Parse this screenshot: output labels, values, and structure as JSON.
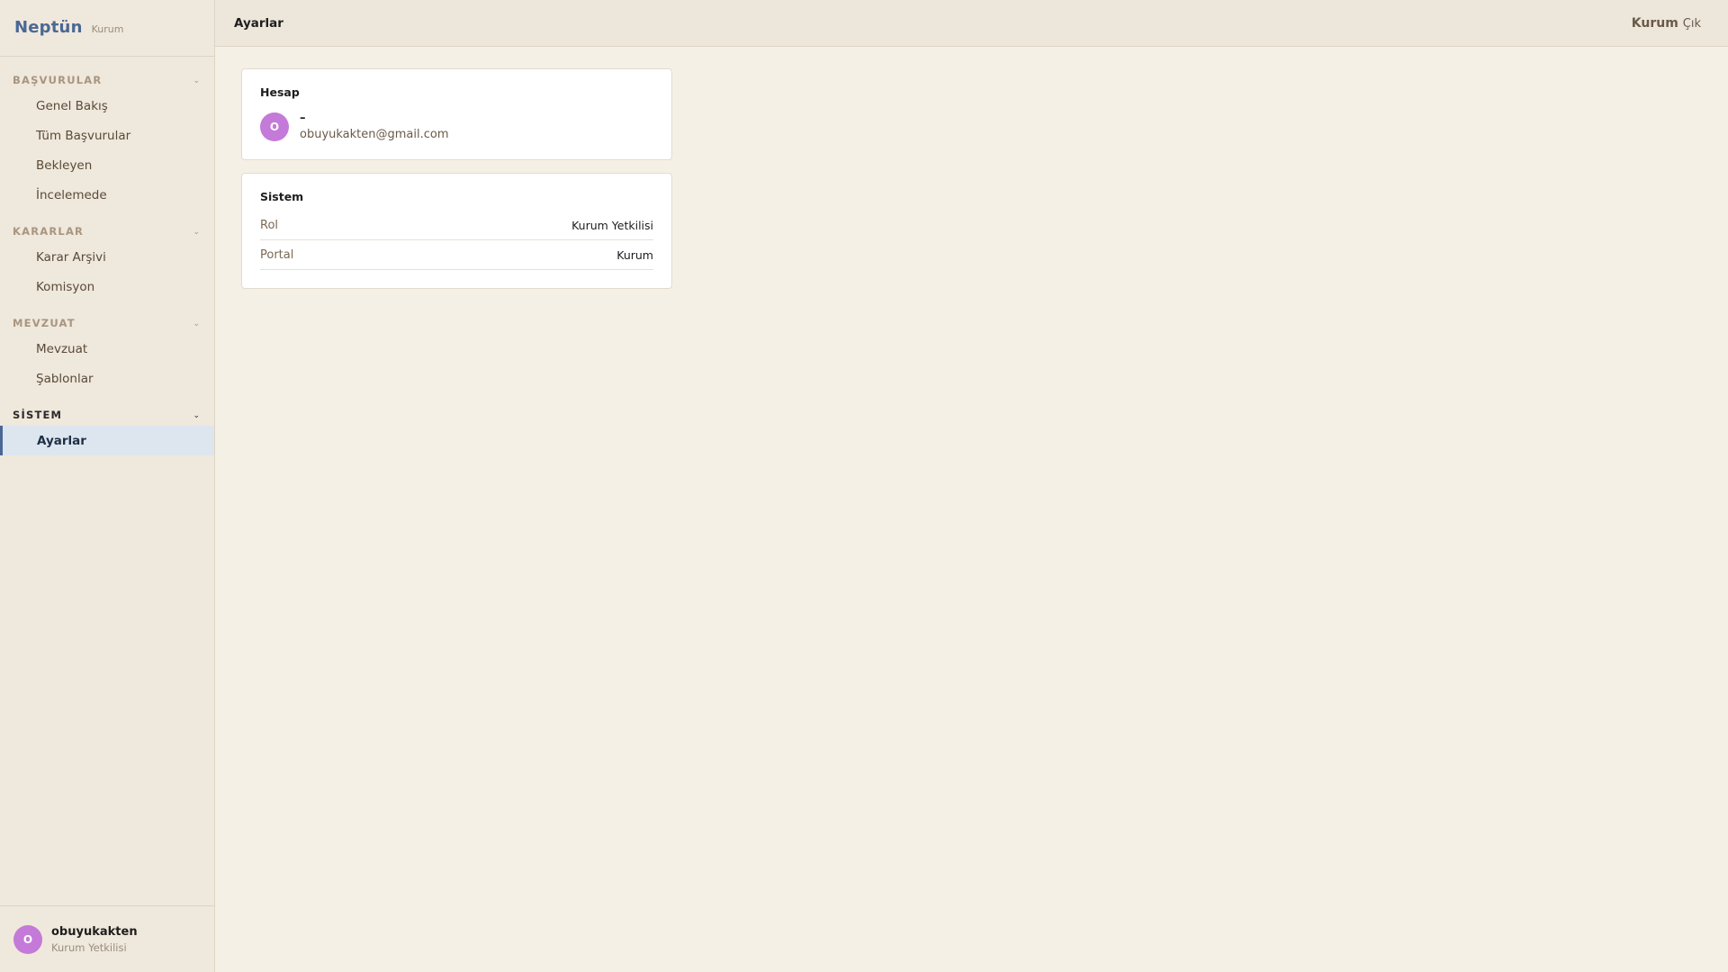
{
  "brand": {
    "name": "Neptün",
    "sub": "Kurum"
  },
  "sidebar": {
    "sections": [
      {
        "title": "BAŞVURULAR",
        "items": [
          {
            "label": "Genel Bakış"
          },
          {
            "label": "Tüm Başvurular"
          },
          {
            "label": "Bekleyen"
          },
          {
            "label": "İncelemede"
          }
        ]
      },
      {
        "title": "KARARLAR",
        "items": [
          {
            "label": "Karar Arşivi"
          },
          {
            "label": "Komisyon"
          }
        ]
      },
      {
        "title": "MEVZUAT",
        "items": [
          {
            "label": "Mevzuat"
          },
          {
            "label": "Şablonlar"
          }
        ]
      },
      {
        "title": "SİSTEM",
        "items": [
          {
            "label": "Ayarlar"
          }
        ]
      }
    ],
    "user": {
      "initial": "O",
      "name": "obuyukakten",
      "role": "Kurum Yetkilisi"
    }
  },
  "topbar": {
    "title": "Ayarlar",
    "portal": "Kurum",
    "logout": "Çık"
  },
  "account_card": {
    "title": "Hesap",
    "initial": "O",
    "name": "–",
    "email": "obuyukakten@gmail.com"
  },
  "system_card": {
    "title": "Sistem",
    "rows": [
      {
        "label": "Rol",
        "value": "Kurum Yetkilisi"
      },
      {
        "label": "Portal",
        "value": "Kurum"
      }
    ]
  },
  "colors": {
    "brand": "#4a6894",
    "avatar": "#c47ad8",
    "selected_bg": "#dde6ef",
    "page_bg": "#f5f0e6",
    "sidebar_bg": "#efe8dc"
  }
}
